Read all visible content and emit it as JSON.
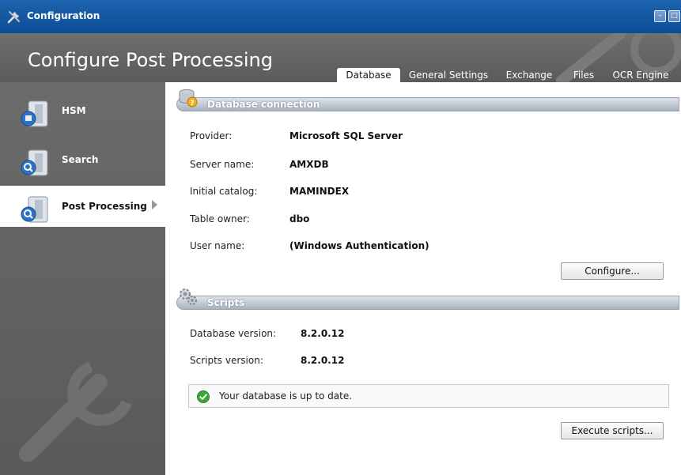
{
  "window": {
    "title": "Configuration",
    "header_title": "Configure Post Processing",
    "controls": {
      "minimize": "–",
      "maximize": "□",
      "close": "✕"
    }
  },
  "tabs": [
    {
      "label": "Database",
      "active": true
    },
    {
      "label": "General Settings",
      "active": false
    },
    {
      "label": "Exchange",
      "active": false
    },
    {
      "label": "Files",
      "active": false
    },
    {
      "label": "OCR Engine",
      "active": false
    }
  ],
  "sidebar": {
    "items": [
      {
        "label": "HSM",
        "icon": "database-server-icon",
        "active": false
      },
      {
        "label": "Search",
        "icon": "database-search-icon",
        "active": false
      },
      {
        "label": "Post Processing",
        "icon": "database-search-icon",
        "active": true
      }
    ]
  },
  "database_connection": {
    "title": "Database connection",
    "icon": "database-warning-icon",
    "fields": [
      {
        "label": "Provider:",
        "value": "Microsoft SQL Server"
      },
      {
        "label": "Server name:",
        "value": "AMXDB"
      },
      {
        "label": "Initial catalog:",
        "value": "MAMINDEX"
      },
      {
        "label": "Table owner:",
        "value": "dbo"
      },
      {
        "label": "User name:",
        "value": "(Windows Authentication)"
      }
    ],
    "configure_button": "Configure..."
  },
  "scripts": {
    "title": "Scripts",
    "icon": "gears-icon",
    "fields": [
      {
        "label": "Database version:",
        "value": "8.2.0.12"
      },
      {
        "label": "Scripts version:",
        "value": "8.2.0.12"
      }
    ],
    "status_message": "Your database is up to date.",
    "execute_button": "Execute scripts..."
  },
  "colors": {
    "titlebar": "#1e63ae",
    "header": "#666666",
    "section_bar": "#b3bcc7",
    "ok_green": "#3aa832"
  }
}
